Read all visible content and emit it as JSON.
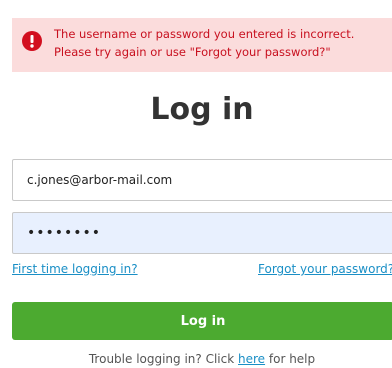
{
  "error": {
    "icon": "exclamation-circle-icon",
    "line1": "The username or password you entered is incorrect.",
    "line2": "Please try again or use \"Forgot your password?\""
  },
  "title": "Log in",
  "form": {
    "email_value": "c.jones@arbor-mail.com",
    "password_value": "••••••••",
    "first_time_link": "First time logging in?",
    "forgot_link": "Forgot your password?",
    "submit_label": "Log in"
  },
  "help": {
    "prefix": "Trouble logging in? Click ",
    "link": "here",
    "suffix": " for help"
  },
  "colors": {
    "error_bg": "#fbdcdc",
    "error_text": "#c8101f",
    "accent_green": "#4caa30",
    "link_blue": "#1a8fc6"
  }
}
